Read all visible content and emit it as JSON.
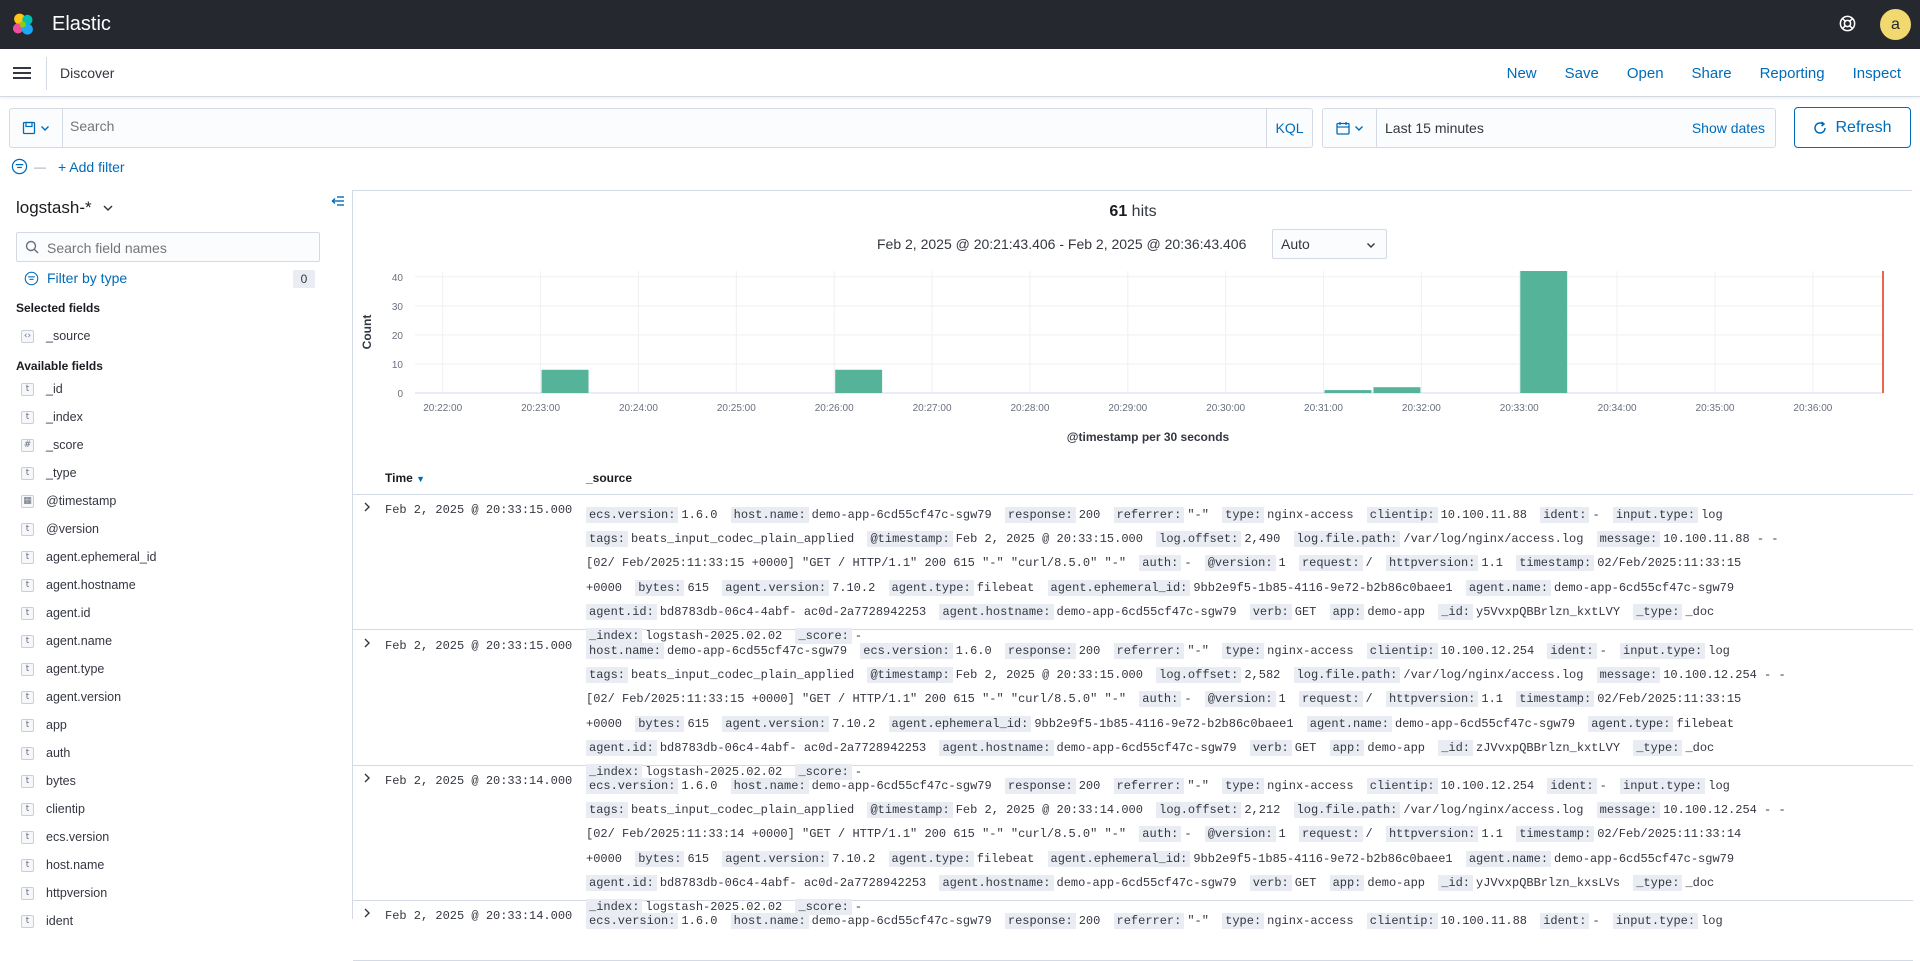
{
  "app": {
    "brand": "Elastic",
    "avatar_letter": "a",
    "breadcrumb": "Discover"
  },
  "nav_links": [
    "New",
    "Save",
    "Open",
    "Share",
    "Reporting",
    "Inspect"
  ],
  "query": {
    "placeholder": "Search",
    "language": "KQL"
  },
  "time": {
    "range_label": "Last 15 minutes",
    "show_dates": "Show dates",
    "refresh_label": "Refresh"
  },
  "filters": {
    "add_label": "+ Add filter"
  },
  "sidebar": {
    "index_pattern": "logstash-*",
    "search_placeholder": "Search field names",
    "filter_by_type": "Filter by type",
    "filter_count": "0",
    "selected_title": "Selected fields",
    "selected_fields": [
      {
        "name": "_source",
        "type": "source"
      }
    ],
    "available_title": "Available fields",
    "available_fields": [
      {
        "name": "_id",
        "type": "t"
      },
      {
        "name": "_index",
        "type": "t"
      },
      {
        "name": "_score",
        "type": "#"
      },
      {
        "name": "_type",
        "type": "t"
      },
      {
        "name": "@timestamp",
        "type": "date"
      },
      {
        "name": "@version",
        "type": "t"
      },
      {
        "name": "agent.ephemeral_id",
        "type": "t"
      },
      {
        "name": "agent.hostname",
        "type": "t"
      },
      {
        "name": "agent.id",
        "type": "t"
      },
      {
        "name": "agent.name",
        "type": "t"
      },
      {
        "name": "agent.type",
        "type": "t"
      },
      {
        "name": "agent.version",
        "type": "t"
      },
      {
        "name": "app",
        "type": "t"
      },
      {
        "name": "auth",
        "type": "t"
      },
      {
        "name": "bytes",
        "type": "t"
      },
      {
        "name": "clientip",
        "type": "t"
      },
      {
        "name": "ecs.version",
        "type": "t"
      },
      {
        "name": "host.name",
        "type": "t"
      },
      {
        "name": "httpversion",
        "type": "t"
      },
      {
        "name": "ident",
        "type": "t"
      }
    ]
  },
  "results": {
    "hits_count": "61",
    "hits_label": "hits",
    "date_range": "Feb 2, 2025 @ 20:21:43.406 - Feb 2, 2025 @ 20:36:43.406",
    "interval": "Auto",
    "col_time": "Time",
    "col_source": "_source"
  },
  "chart_data": {
    "type": "bar",
    "x_ticks": [
      "20:22:00",
      "20:23:00",
      "20:24:00",
      "20:25:00",
      "20:26:00",
      "20:27:00",
      "20:28:00",
      "20:29:00",
      "20:30:00",
      "20:31:00",
      "20:32:00",
      "20:33:00",
      "20:34:00",
      "20:35:00",
      "20:36:00"
    ],
    "bars": [
      {
        "x": "20:23:00",
        "count": 8
      },
      {
        "x": "20:26:00",
        "count": 8
      },
      {
        "x": "20:31:00",
        "count": 1
      },
      {
        "x": "20:31:30",
        "count": 2
      },
      {
        "x": "20:33:00",
        "count": 42
      }
    ],
    "y_ticks": [
      0,
      10,
      20,
      30,
      40
    ],
    "ylim": [
      0,
      42
    ],
    "ylabel": "Count",
    "xlabel": "@timestamp per 30 seconds",
    "x_start": "20:21:43",
    "x_end": "20:36:43",
    "now_marker": "20:36:43",
    "bar_color": "#54b399",
    "now_color": "#e7664c",
    "grid": true
  },
  "rows": [
    {
      "time": "Feb 2, 2025 @ 20:33:15.000",
      "fields": [
        [
          "ecs.version:",
          "1.6.0"
        ],
        [
          "host.name:",
          "demo-app-6cd55cf47c-sgw79"
        ],
        [
          "response:",
          "200"
        ],
        [
          "referrer:",
          "\"-\""
        ],
        [
          "type:",
          "nginx-access"
        ],
        [
          "clientip:",
          "10.100.11.88"
        ],
        [
          "ident:",
          "-"
        ],
        [
          "input.type:",
          "log"
        ],
        [
          "tags:",
          "beats_input_codec_plain_applied"
        ],
        [
          "@timestamp:",
          "Feb 2, 2025 @ 20:33:15.000"
        ],
        [
          "log.offset:",
          "2,490"
        ],
        [
          "log.file.path:",
          "/var/log/nginx/access.log"
        ],
        [
          "message:",
          "10.100.11.88 - - [02/ Feb/2025:11:33:15 +0000] \"GET / HTTP/1.1\" 200 615 \"-\" \"curl/8.5.0\" \"-\""
        ],
        [
          "auth:",
          "-"
        ],
        [
          "@version:",
          "1"
        ],
        [
          "request:",
          "/"
        ],
        [
          "httpversion:",
          "1.1"
        ],
        [
          "timestamp:",
          "02/Feb/2025:11:33:15 +0000"
        ],
        [
          "bytes:",
          "615"
        ],
        [
          "agent.version:",
          "7.10.2"
        ],
        [
          "agent.type:",
          "filebeat"
        ],
        [
          "agent.ephemeral_id:",
          "9bb2e9f5-1b85-4116-9e72-b2b86c0baee1"
        ],
        [
          "agent.name:",
          "demo-app-6cd55cf47c-sgw79"
        ],
        [
          "agent.id:",
          "bd8783db-06c4-4abf- ac0d-2a7728942253"
        ],
        [
          "agent.hostname:",
          "demo-app-6cd55cf47c-sgw79"
        ],
        [
          "verb:",
          "GET"
        ],
        [
          "app:",
          "demo-app"
        ],
        [
          "_id:",
          "y5VvxpQBBrlzn_kxtLVY"
        ],
        [
          "_type:",
          "_doc"
        ],
        [
          "_index:",
          "logstash-2025.02.02"
        ],
        [
          "_score:",
          "-"
        ]
      ]
    },
    {
      "time": "Feb 2, 2025 @ 20:33:15.000",
      "fields": [
        [
          "host.name:",
          "demo-app-6cd55cf47c-sgw79"
        ],
        [
          "ecs.version:",
          "1.6.0"
        ],
        [
          "response:",
          "200"
        ],
        [
          "referrer:",
          "\"-\""
        ],
        [
          "type:",
          "nginx-access"
        ],
        [
          "clientip:",
          "10.100.12.254"
        ],
        [
          "ident:",
          "-"
        ],
        [
          "input.type:",
          "log"
        ],
        [
          "tags:",
          "beats_input_codec_plain_applied"
        ],
        [
          "@timestamp:",
          "Feb 2, 2025 @ 20:33:15.000"
        ],
        [
          "log.offset:",
          "2,582"
        ],
        [
          "log.file.path:",
          "/var/log/nginx/access.log"
        ],
        [
          "message:",
          "10.100.12.254 - - [02/ Feb/2025:11:33:15 +0000] \"GET / HTTP/1.1\" 200 615 \"-\" \"curl/8.5.0\" \"-\""
        ],
        [
          "auth:",
          "-"
        ],
        [
          "@version:",
          "1"
        ],
        [
          "request:",
          "/"
        ],
        [
          "httpversion:",
          "1.1"
        ],
        [
          "timestamp:",
          "02/Feb/2025:11:33:15 +0000"
        ],
        [
          "bytes:",
          "615"
        ],
        [
          "agent.version:",
          "7.10.2"
        ],
        [
          "agent.ephemeral_id:",
          "9bb2e9f5-1b85-4116-9e72-b2b86c0baee1"
        ],
        [
          "agent.name:",
          "demo-app-6cd55cf47c-sgw79"
        ],
        [
          "agent.type:",
          "filebeat"
        ],
        [
          "agent.id:",
          "bd8783db-06c4-4abf- ac0d-2a7728942253"
        ],
        [
          "agent.hostname:",
          "demo-app-6cd55cf47c-sgw79"
        ],
        [
          "verb:",
          "GET"
        ],
        [
          "app:",
          "demo-app"
        ],
        [
          "_id:",
          "zJVvxpQBBrlzn_kxtLVY"
        ],
        [
          "_type:",
          "_doc"
        ],
        [
          "_index:",
          "logstash-2025.02.02"
        ],
        [
          "_score:",
          "-"
        ]
      ]
    },
    {
      "time": "Feb 2, 2025 @ 20:33:14.000",
      "fields": [
        [
          "ecs.version:",
          "1.6.0"
        ],
        [
          "host.name:",
          "demo-app-6cd55cf47c-sgw79"
        ],
        [
          "response:",
          "200"
        ],
        [
          "referrer:",
          "\"-\""
        ],
        [
          "type:",
          "nginx-access"
        ],
        [
          "clientip:",
          "10.100.12.254"
        ],
        [
          "ident:",
          "-"
        ],
        [
          "input.type:",
          "log"
        ],
        [
          "tags:",
          "beats_input_codec_plain_applied"
        ],
        [
          "@timestamp:",
          "Feb 2, 2025 @ 20:33:14.000"
        ],
        [
          "log.offset:",
          "2,212"
        ],
        [
          "log.file.path:",
          "/var/log/nginx/access.log"
        ],
        [
          "message:",
          "10.100.12.254 - - [02/ Feb/2025:11:33:14 +0000] \"GET / HTTP/1.1\" 200 615 \"-\" \"curl/8.5.0\" \"-\""
        ],
        [
          "auth:",
          "-"
        ],
        [
          "@version:",
          "1"
        ],
        [
          "request:",
          "/"
        ],
        [
          "httpversion:",
          "1.1"
        ],
        [
          "timestamp:",
          "02/Feb/2025:11:33:14 +0000"
        ],
        [
          "bytes:",
          "615"
        ],
        [
          "agent.version:",
          "7.10.2"
        ],
        [
          "agent.type:",
          "filebeat"
        ],
        [
          "agent.ephemeral_id:",
          "9bb2e9f5-1b85-4116-9e72-b2b86c0baee1"
        ],
        [
          "agent.name:",
          "demo-app-6cd55cf47c-sgw79"
        ],
        [
          "agent.id:",
          "bd8783db-06c4-4abf- ac0d-2a7728942253"
        ],
        [
          "agent.hostname:",
          "demo-app-6cd55cf47c-sgw79"
        ],
        [
          "verb:",
          "GET"
        ],
        [
          "app:",
          "demo-app"
        ],
        [
          "_id:",
          "yJVvxpQBBrlzn_kxsLVs"
        ],
        [
          "_type:",
          "_doc"
        ],
        [
          "_index:",
          "logstash-2025.02.02"
        ],
        [
          "_score:",
          "-"
        ]
      ]
    },
    {
      "time": "Feb 2, 2025 @ 20:33:14.000",
      "fields": [
        [
          "ecs.version:",
          "1.6.0"
        ],
        [
          "host.name:",
          "demo-app-6cd55cf47c-sgw79"
        ],
        [
          "response:",
          "200"
        ],
        [
          "referrer:",
          "\"-\""
        ],
        [
          "type:",
          "nginx-access"
        ],
        [
          "clientip:",
          "10.100.11.88"
        ],
        [
          "ident:",
          "-"
        ],
        [
          "input.type:",
          "log"
        ]
      ]
    }
  ]
}
